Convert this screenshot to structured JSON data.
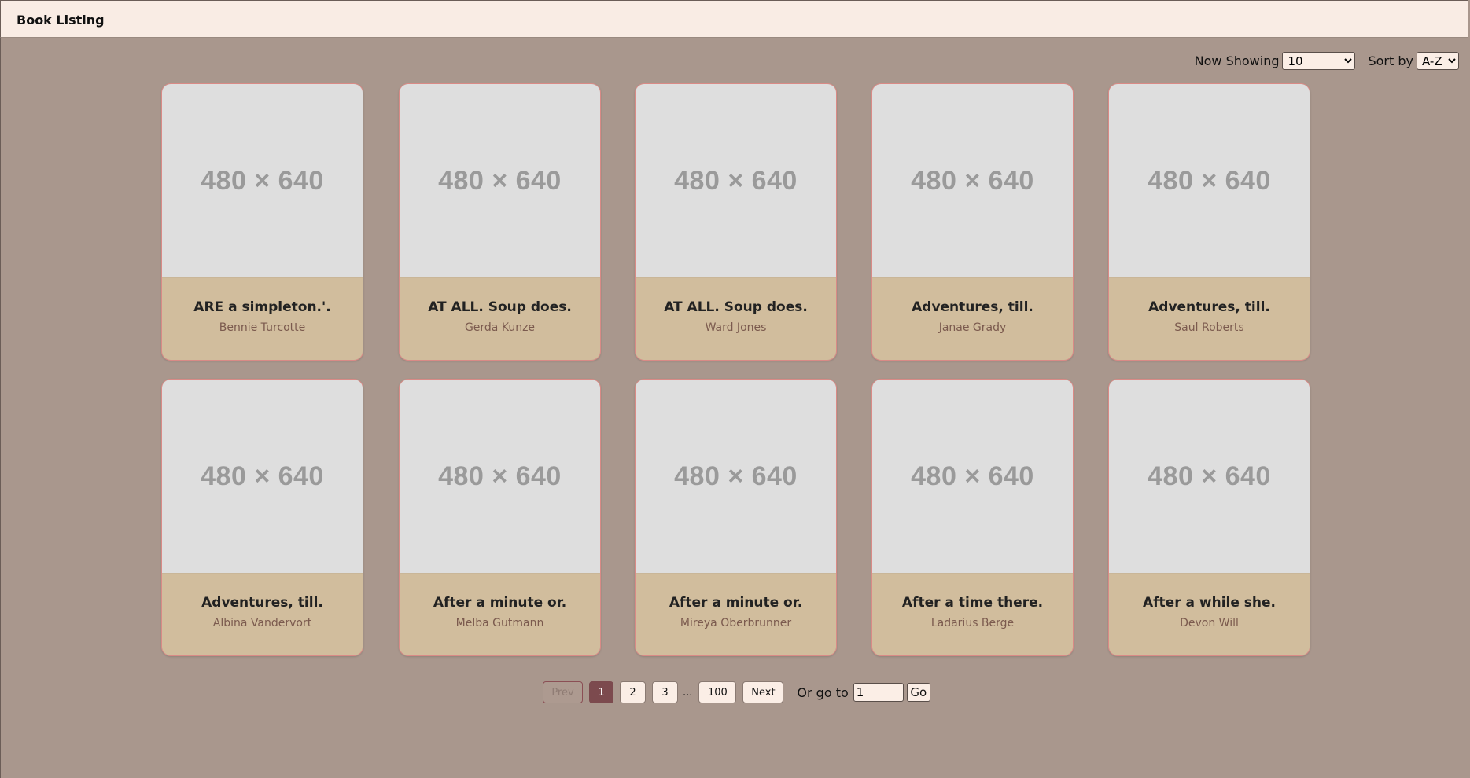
{
  "header": {
    "title": "Book Listing"
  },
  "controls": {
    "now_showing_label": "Now Showing",
    "now_showing_value": "10",
    "sort_by_label": "Sort by",
    "sort_by_value": "A-Z"
  },
  "cover_placeholder": "480 × 640",
  "books": [
    {
      "title": "ARE a simpleton.'.",
      "author": "Bennie Turcotte"
    },
    {
      "title": "AT ALL. Soup does.",
      "author": "Gerda Kunze"
    },
    {
      "title": "AT ALL. Soup does.",
      "author": "Ward Jones"
    },
    {
      "title": "Adventures, till.",
      "author": "Janae Grady"
    },
    {
      "title": "Adventures, till.",
      "author": "Saul Roberts"
    },
    {
      "title": "Adventures, till.",
      "author": "Albina Vandervort"
    },
    {
      "title": "After a minute or.",
      "author": "Melba Gutmann"
    },
    {
      "title": "After a minute or.",
      "author": "Mireya Oberbrunner"
    },
    {
      "title": "After a time there.",
      "author": "Ladarius Berge"
    },
    {
      "title": "After a while she.",
      "author": "Devon Will"
    }
  ],
  "pagination": {
    "prev_label": "Prev",
    "pages": [
      "1",
      "2",
      "3"
    ],
    "ellipsis": "...",
    "last_page": "100",
    "next_label": "Next",
    "current_page": "1",
    "goto_label": "Or go to",
    "goto_value": "1",
    "go_label": "Go"
  },
  "colors": {
    "page_background": "#a9978d",
    "header_background": "#f9ece4",
    "cover_background": "#dedede",
    "card_info_background": "#d1bd9d",
    "card_border": "#d98a86",
    "active_page": "#7c4a4e"
  }
}
